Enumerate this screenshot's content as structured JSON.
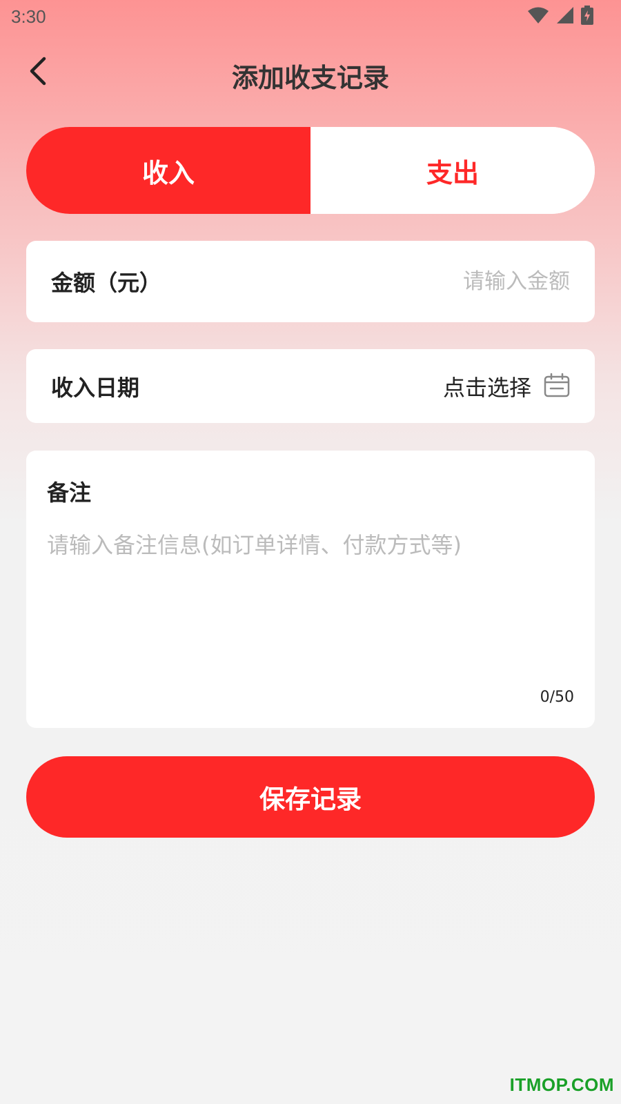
{
  "status_bar": {
    "time": "3:30",
    "icons": [
      "wifi-icon",
      "signal-icon",
      "battery-charging-icon"
    ]
  },
  "header": {
    "title": "添加收支记录",
    "back_icon": "chevron-left-icon"
  },
  "type_toggle": {
    "income_label": "收入",
    "expense_label": "支出",
    "selected": "收入"
  },
  "amount": {
    "label": "金额（元）",
    "value": "",
    "placeholder": "请输入金额"
  },
  "date": {
    "label": "收入日期",
    "value": "点击选择",
    "icon": "calendar-icon"
  },
  "note": {
    "label": "备注",
    "value": "",
    "placeholder": "请输入备注信息(如订单详情、付款方式等)",
    "counter": "0/50"
  },
  "save_button": {
    "label": "保存记录"
  },
  "watermark": "ITMOP.COM",
  "colors": {
    "accent": "#fe2828",
    "header_gradient_top": "#fd9393",
    "background": "#f3f3f3",
    "watermark": "#1aa028"
  }
}
